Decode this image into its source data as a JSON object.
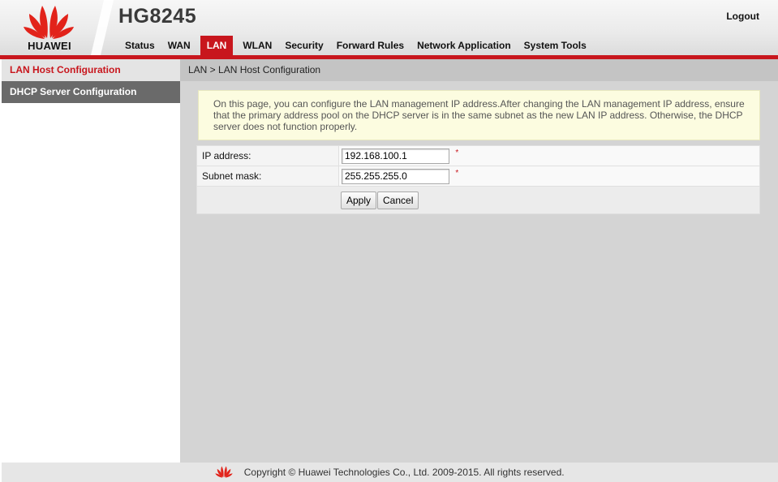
{
  "brand": {
    "logo_text": "HUAWEI",
    "model": "HG8245",
    "logo_icon": "huawei-petal-logo",
    "accent_color": "#c8161d"
  },
  "header": {
    "logout_label": "Logout"
  },
  "nav": {
    "items": [
      {
        "label": "Status"
      },
      {
        "label": "WAN"
      },
      {
        "label": "LAN",
        "active": true
      },
      {
        "label": "WLAN"
      },
      {
        "label": "Security"
      },
      {
        "label": "Forward Rules"
      },
      {
        "label": "Network Application"
      },
      {
        "label": "System Tools"
      }
    ]
  },
  "sidebar": {
    "items": [
      {
        "label": "LAN Host Configuration",
        "selected": true
      },
      {
        "label": "DHCP Server Configuration",
        "selected": false
      }
    ]
  },
  "main": {
    "breadcrumb": "LAN > LAN Host Configuration",
    "notice": "On this page, you can configure the LAN management IP address.After changing the LAN management IP address, ensure that the primary address pool on the DHCP server is in the same subnet as the new LAN IP address. Otherwise, the DHCP server does not function properly.",
    "form": {
      "ip_label": "IP address:",
      "ip_value": "192.168.100.1",
      "mask_label": "Subnet mask:",
      "mask_value": "255.255.255.0",
      "required_marker": "*"
    },
    "buttons": {
      "apply": "Apply",
      "cancel": "Cancel"
    }
  },
  "footer": {
    "copyright": "Copyright © Huawei Technologies Co., Ltd. 2009-2015. All rights reserved."
  }
}
